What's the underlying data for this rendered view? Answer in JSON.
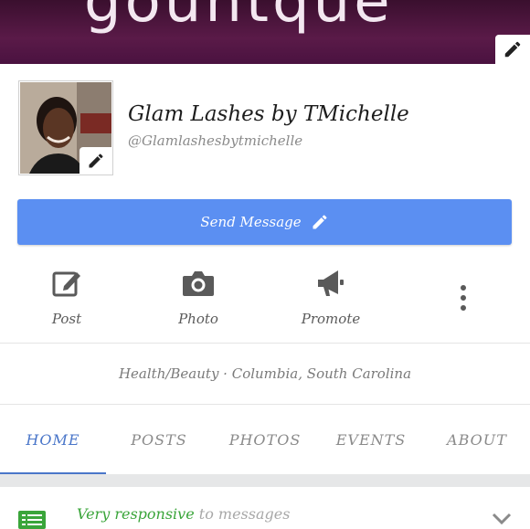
{
  "cover": {
    "text": "gountque",
    "edit_icon": "pencil-icon",
    "background": "#4a1240"
  },
  "profile": {
    "name": "Glam Lashes by TMichelle",
    "handle": "@Glamlashesbytmichelle",
    "edit_icon": "pencil-icon"
  },
  "send_message": {
    "label": "Send Message",
    "icon": "pencil-icon",
    "color": "#5b8ff2"
  },
  "actions": [
    {
      "label": "Post",
      "icon": "compose-icon"
    },
    {
      "label": "Photo",
      "icon": "camera-icon"
    },
    {
      "label": "Promote",
      "icon": "megaphone-icon"
    },
    {
      "label": "",
      "icon": "more-vertical-icon"
    }
  ],
  "category": "Health/Beauty · Columbia, South Carolina",
  "tabs": [
    {
      "label": "HOME",
      "active": true
    },
    {
      "label": "POSTS",
      "active": false
    },
    {
      "label": "PHOTOS",
      "active": false
    },
    {
      "label": "EVENTS",
      "active": false
    },
    {
      "label": "ABOUT",
      "active": false
    }
  ],
  "responsiveness": {
    "strong": "Very responsive",
    "weak": "to messages",
    "icon": "message-lines-icon",
    "color": "#3aa53a"
  },
  "colors": {
    "accent": "#4a76c9",
    "button": "#5b8ff2",
    "green": "#3aa53a"
  }
}
